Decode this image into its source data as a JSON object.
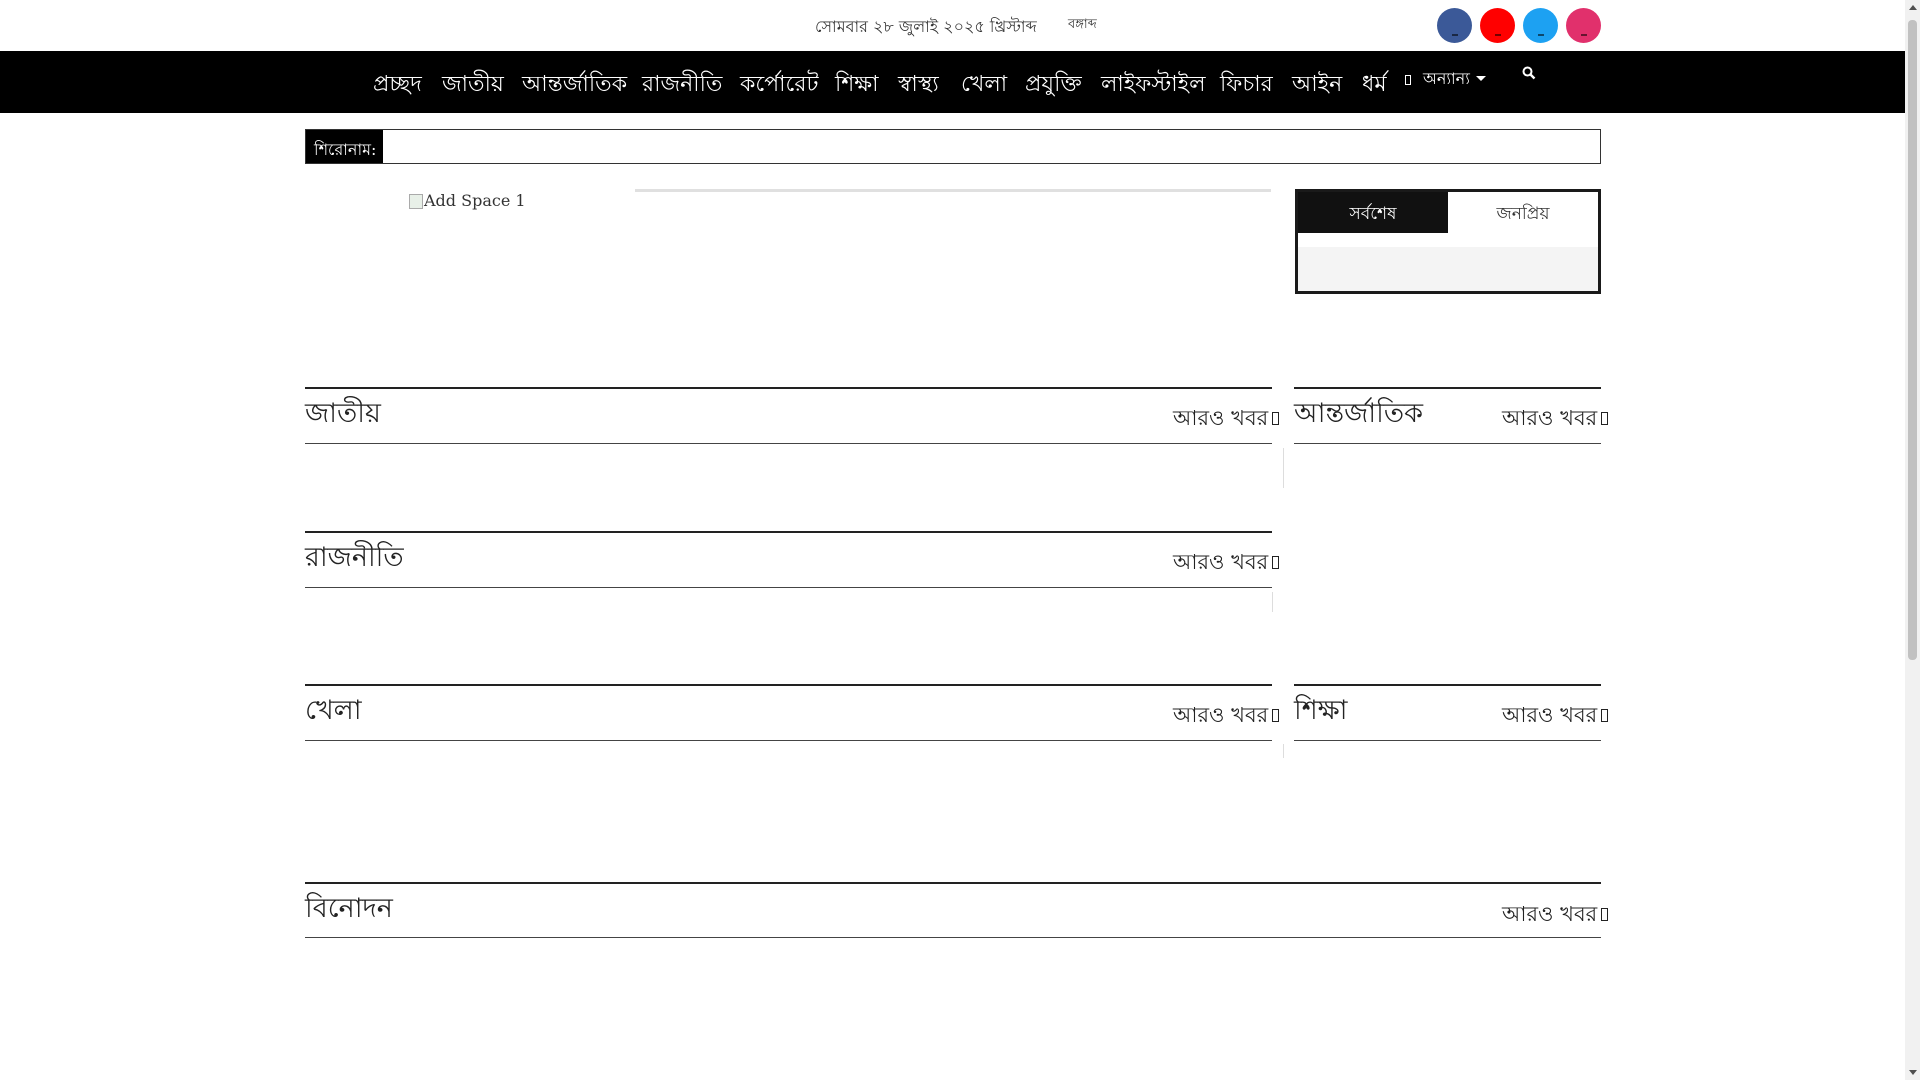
{
  "topbar": {
    "date": "সোমবার ২৮ জুলাই ২০২৫ খ্রিস্টাব্দ",
    "calendar": "বঙ্গাব্দ",
    "social": [
      {
        "name": "facebook-icon",
        "color": "#3b5998"
      },
      {
        "name": "youtube-icon",
        "color": "#ff0000"
      },
      {
        "name": "twitter-icon",
        "color": "#1da1f2"
      },
      {
        "name": "instagram-icon",
        "color": "#e1306c"
      }
    ]
  },
  "nav": {
    "items": [
      "প্রচ্ছদ",
      "জাতীয়",
      "আন্তর্জাতিক",
      "রাজনীতি",
      "কর্পোরেট",
      "শিক্ষা",
      "স্বাস্থ্য",
      "খেলা",
      "প্রযুক্তি",
      "লাইফস্টাইল",
      "ফিচার",
      "আইন",
      "ধর্ম"
    ],
    "dropdown": "অন্যান্য"
  },
  "ticker": {
    "label": "শিরোনাম:"
  },
  "ad": {
    "alt": "Add Space 1"
  },
  "tabs": {
    "latest": "সর্বশেষ",
    "popular": "জনপ্রিয়"
  },
  "sections": {
    "national": "জাতীয়",
    "international": "আন্তর্জাতিক",
    "politics": "রাজনীতি",
    "sports": "খেলা",
    "education": "শিক্ষা",
    "entertainment": "বিনোদন",
    "more": "আরও খবর"
  }
}
